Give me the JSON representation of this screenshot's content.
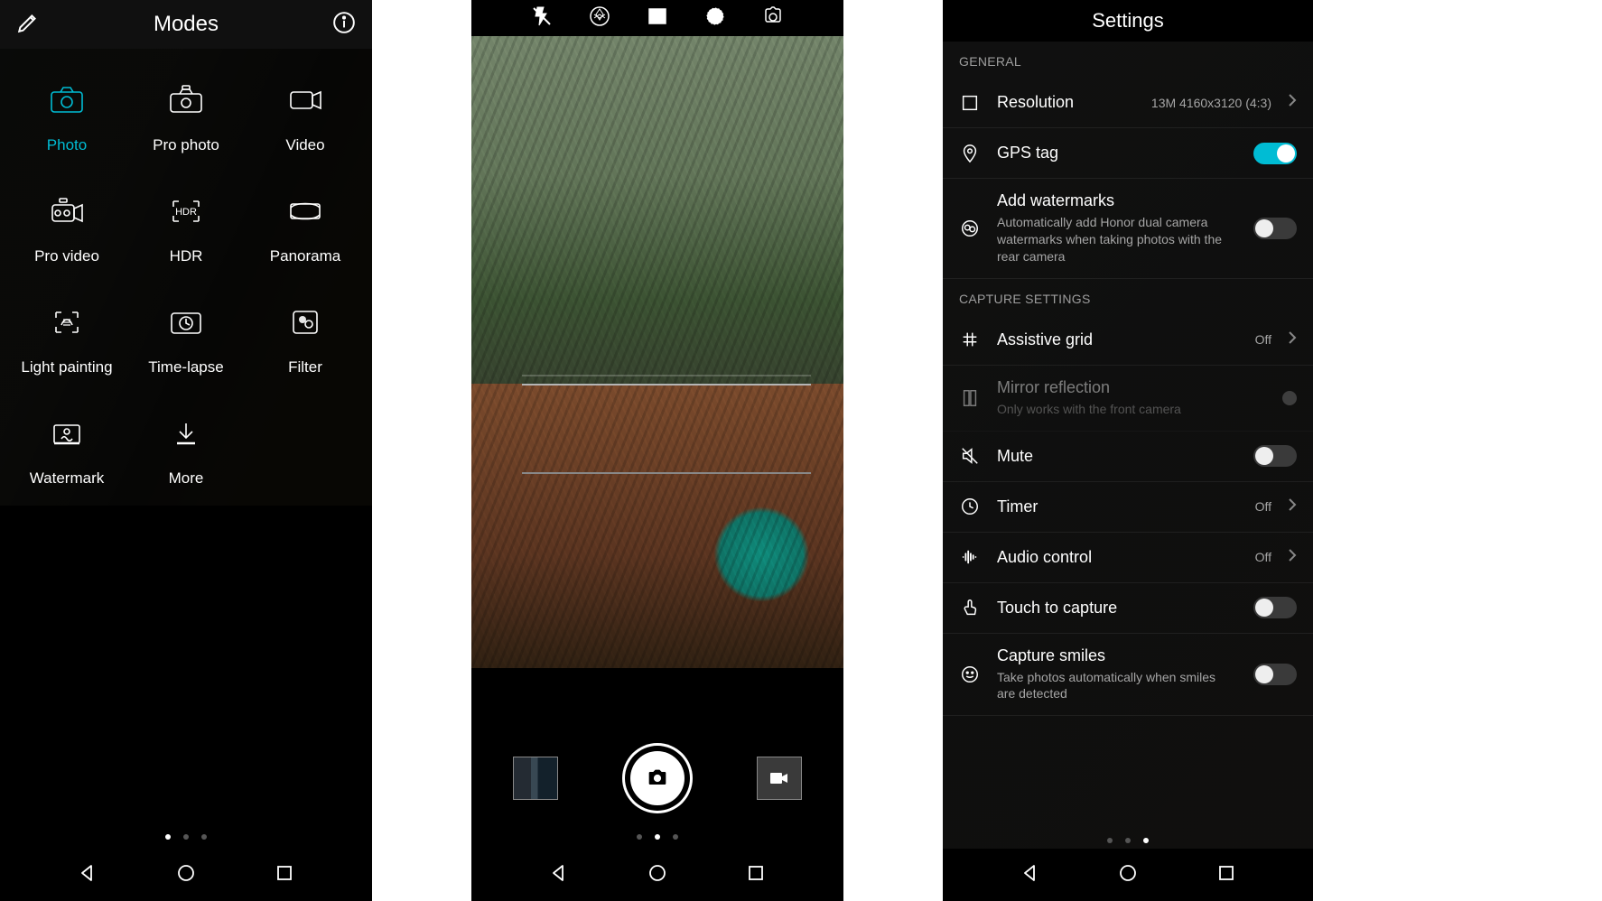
{
  "panel1": {
    "title": "Modes",
    "modes": [
      {
        "id": "photo",
        "label": "Photo",
        "active": true
      },
      {
        "id": "pro-photo",
        "label": "Pro photo"
      },
      {
        "id": "video",
        "label": "Video"
      },
      {
        "id": "pro-video",
        "label": "Pro video"
      },
      {
        "id": "hdr",
        "label": "HDR",
        "badge": "HDR"
      },
      {
        "id": "panorama",
        "label": "Panorama"
      },
      {
        "id": "light-painting",
        "label": "Light painting"
      },
      {
        "id": "time-lapse",
        "label": "Time-lapse"
      },
      {
        "id": "filter",
        "label": "Filter"
      },
      {
        "id": "watermark",
        "label": "Watermark"
      },
      {
        "id": "more",
        "label": "More"
      }
    ],
    "page_dots": {
      "total": 3,
      "active": 0
    }
  },
  "panel2": {
    "top_icons": [
      "flash-off",
      "shutter-effect",
      "frame",
      "hdr-ring",
      "switch-camera"
    ],
    "page_dots": {
      "total": 3,
      "active": 1
    }
  },
  "panel3": {
    "title": "Settings",
    "sections": [
      {
        "label": "GENERAL",
        "rows": [
          {
            "id": "resolution",
            "icon": "frame",
            "title": "Resolution",
            "value": "13M 4160x3120 (4:3)",
            "type": "nav"
          },
          {
            "id": "gps",
            "icon": "pin",
            "title": "GPS tag",
            "type": "switch",
            "on": true
          },
          {
            "id": "watermarks",
            "icon": "watermark-dual",
            "title": "Add watermarks",
            "sub": "Automatically add Honor dual camera watermarks when taking photos with the rear camera",
            "type": "switch",
            "on": false
          }
        ]
      },
      {
        "label": "CAPTURE SETTINGS",
        "rows": [
          {
            "id": "grid",
            "icon": "grid",
            "title": "Assistive grid",
            "value": "Off",
            "type": "nav"
          },
          {
            "id": "mirror",
            "icon": "mirror",
            "title": "Mirror reflection",
            "sub": "Only works with the front camera",
            "type": "dot",
            "disabled": true
          },
          {
            "id": "mute",
            "icon": "mute",
            "title": "Mute",
            "type": "switch",
            "on": false
          },
          {
            "id": "timer",
            "icon": "clock",
            "title": "Timer",
            "value": "Off",
            "type": "nav"
          },
          {
            "id": "audio",
            "icon": "audio",
            "title": "Audio control",
            "value": "Off",
            "type": "nav"
          },
          {
            "id": "touch",
            "icon": "touch",
            "title": "Touch to capture",
            "type": "switch",
            "on": false
          },
          {
            "id": "smiles",
            "icon": "smile",
            "title": "Capture smiles",
            "sub": "Take photos automatically when smiles are detected",
            "type": "switch",
            "on": false
          }
        ]
      }
    ],
    "page_dots": {
      "total": 3,
      "active": 2
    }
  },
  "accent": "#00bcd4"
}
